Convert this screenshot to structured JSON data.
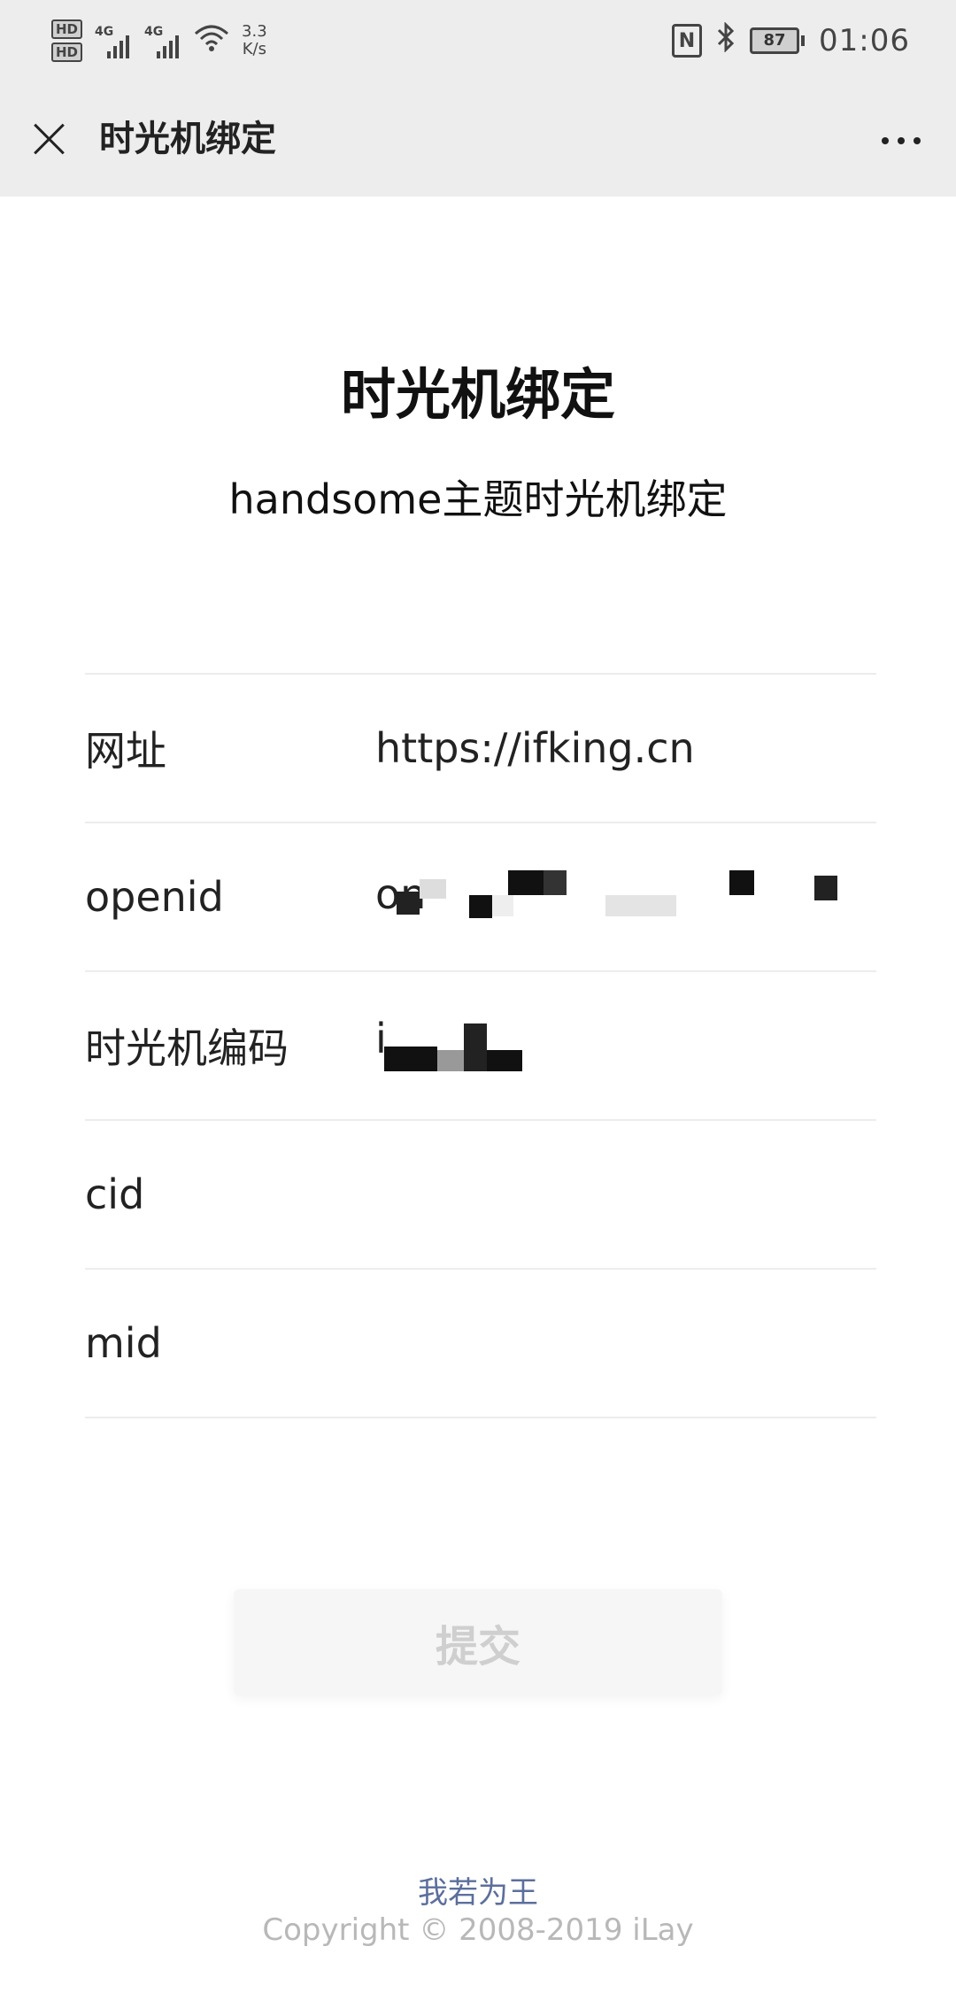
{
  "status_bar": {
    "hd_label": "HD",
    "net_1": "4G",
    "net_2": "4G",
    "speed_value": "3.3",
    "speed_unit": "K/s",
    "nfc_label": "N",
    "battery": "87",
    "time": "01:06"
  },
  "titlebar": {
    "title": "时光机绑定"
  },
  "page": {
    "heading": "时光机绑定",
    "subheading": "handsome主题时光机绑定"
  },
  "form": {
    "rows": [
      {
        "label": "网址",
        "value": "https://ifking.cn"
      },
      {
        "label": "openid",
        "value": "on"
      },
      {
        "label": "时光机编码",
        "value": "i"
      },
      {
        "label": "cid",
        "value": ""
      },
      {
        "label": "mid",
        "value": ""
      }
    ]
  },
  "submit_label": "提交",
  "footer": {
    "link": "我若为王",
    "copyright": "Copyright © 2008-2019 iLay"
  }
}
